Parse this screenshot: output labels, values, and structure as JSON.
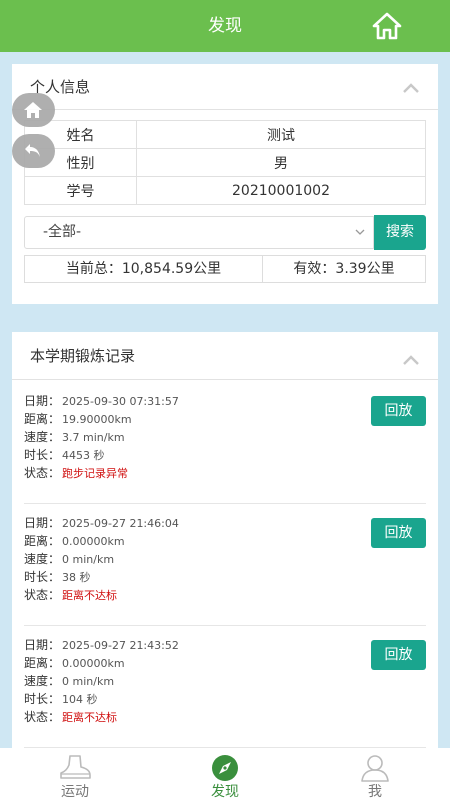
{
  "header": {
    "title": "发现",
    "home_icon": "home-icon"
  },
  "personal": {
    "title": "个人信息",
    "rows": [
      {
        "label": "姓名",
        "value": "测试"
      },
      {
        "label": "性别",
        "value": "男"
      },
      {
        "label": "学号",
        "value": "20210001002"
      }
    ],
    "filter": {
      "selected": "-全部-"
    },
    "search_label": "搜索",
    "total": "当前总：10,854.59公里",
    "valid": "有效：3.39公里"
  },
  "records": {
    "title": "本学期锻炼记录",
    "labels": {
      "date": "日期：",
      "distance": "距离：",
      "speed": "速度：",
      "duration": "时长：",
      "status": "状态："
    },
    "replay_label": "回放",
    "items": [
      {
        "date": "2025-09-30 07:31:57",
        "distance": "19.90000km",
        "speed": "3.7 min/km",
        "duration": "4453 秒",
        "status": "跑步记录异常"
      },
      {
        "date": "2025-09-27 21:46:04",
        "distance": "0.00000km",
        "speed": "0 min/km",
        "duration": "38 秒",
        "status": "距离不达标"
      },
      {
        "date": "2025-09-27 21:43:52",
        "distance": "0.00000km",
        "speed": "0 min/km",
        "duration": "104 秒",
        "status": "距离不达标"
      }
    ]
  },
  "tabs": [
    {
      "label": "运动",
      "icon": "shoe-icon"
    },
    {
      "label": "发现",
      "icon": "compass-icon",
      "active": true
    },
    {
      "label": "我",
      "icon": "person-icon"
    }
  ],
  "colors": {
    "header": "#6bbf4e",
    "accent": "#1aa58e",
    "warning": "#d01010",
    "active_tab": "#3a8f3d"
  }
}
